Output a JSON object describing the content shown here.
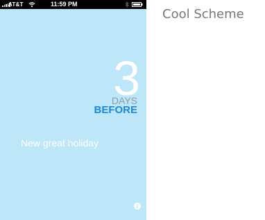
{
  "status_bar": {
    "carrier": "AT&T",
    "time": "11:59 PM"
  },
  "countdown": {
    "number": "3",
    "unit": "DAYS",
    "relation": "BEFORE",
    "event_name": "New great holiday"
  },
  "caption": {
    "scheme_name": "Cool Scheme"
  },
  "icons": {
    "signal": "signal-bars-icon",
    "wifi": "wifi-icon",
    "bluetooth": "bluetooth-icon",
    "battery": "battery-icon",
    "info": "info-icon"
  },
  "colors": {
    "background": "#bde6f8",
    "number": "#ffffff",
    "days": "#8c9aa3",
    "before": "#1e88d8",
    "status_bar": "#000000"
  }
}
